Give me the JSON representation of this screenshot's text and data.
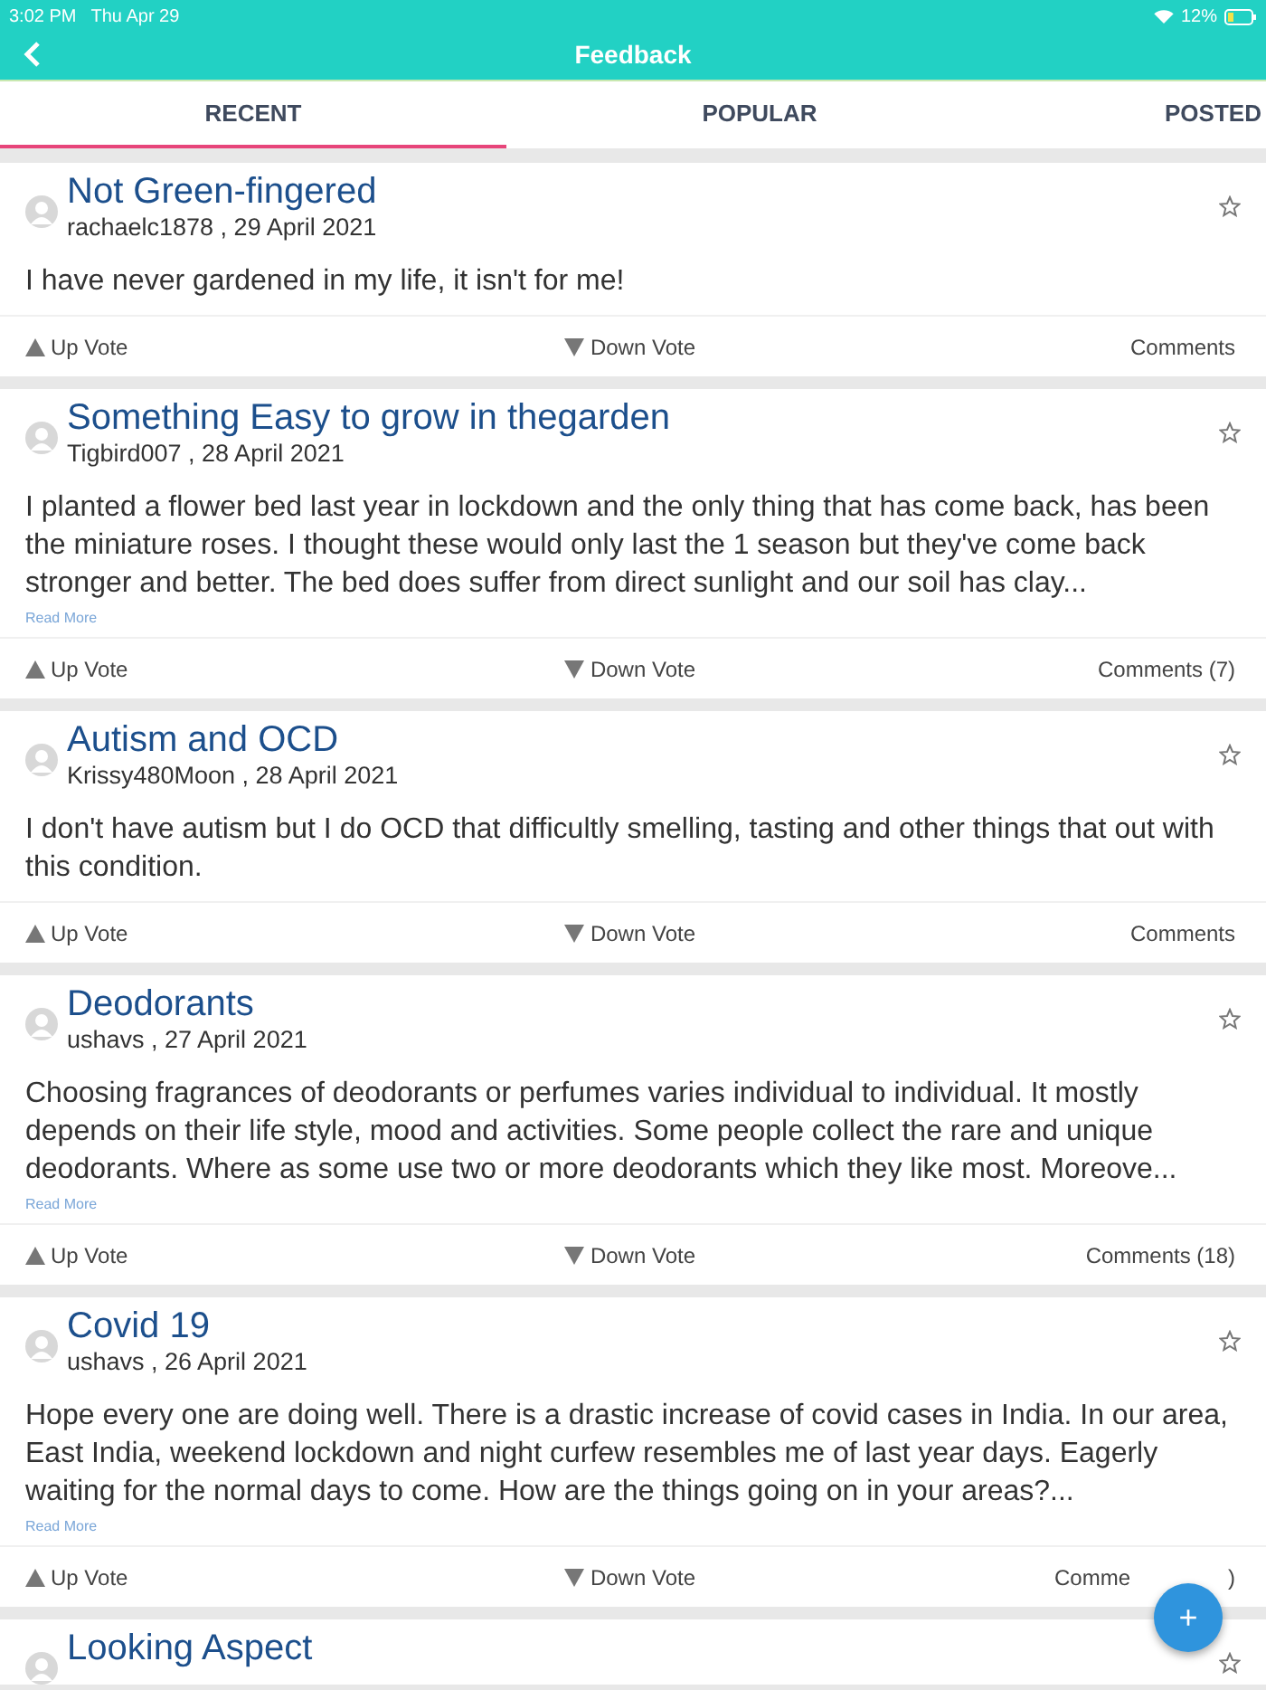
{
  "status_bar": {
    "time": "3:02 PM",
    "date": "Thu Apr 29",
    "battery": "12%"
  },
  "header": {
    "title": "Feedback"
  },
  "tabs": [
    {
      "label": "RECENT",
      "selected": true
    },
    {
      "label": "POPULAR",
      "selected": false
    },
    {
      "label": "POSTED",
      "selected": false
    }
  ],
  "posts": [
    {
      "title": "Not Green-fingered",
      "byline": "rachaelc1878 , 29 April 2021",
      "body": "I have never gardened in my life, it isn't for me!",
      "up_vote": "Up Vote",
      "down_vote": "Down Vote",
      "comments": "Comments"
    },
    {
      "title": "Something Easy to grow in thegarden",
      "byline": "Tigbird007 , 28 April 2021",
      "body": "I planted a flower bed last year in lockdown and the only thing that has come back, has been the miniature roses.  I thought these would only last the 1 season but they've come back stronger and better.  The bed does suffer from direct sunlight and our soil has clay...",
      "read_more": "Read More",
      "up_vote": "Up Vote",
      "down_vote": "Down Vote",
      "comments": "Comments (7)"
    },
    {
      "title": "Autism and OCD",
      "byline": "Krissy480Moon , 28 April 2021",
      "body": "I don't have autism but I do OCD that difficultly smelling, tasting  and other things that out with this condition.",
      "up_vote": "Up Vote",
      "down_vote": "Down Vote",
      "comments": "Comments"
    },
    {
      "title": "Deodorants",
      "byline": "ushavs , 27 April 2021",
      "body": "Choosing fragrances of deodorants or perfumes varies individual to individual. It mostly depends on their life style, mood and activities. Some people collect the rare and unique deodorants. Where as  some use two or more deodorants which they like most. Moreove...",
      "read_more": "Read More",
      "up_vote": "Up Vote",
      "down_vote": "Down Vote",
      "comments": "Comments (18)"
    },
    {
      "title": "Covid 19",
      "byline": "ushavs , 26 April 2021",
      "body": "Hope every one are doing well. There is a drastic increase of covid cases in India. In our area, East India, weekend lockdown and night curfew resembles me of last year days. Eagerly waiting for the normal days to come. How are the things going on in your areas?...",
      "read_more": "Read More",
      "up_vote": "Up Vote",
      "down_vote": "Down Vote",
      "comments": "Comme",
      "comments_tail": ")"
    },
    {
      "title": "Looking Aspect"
    }
  ],
  "fab": {
    "label": "+"
  }
}
